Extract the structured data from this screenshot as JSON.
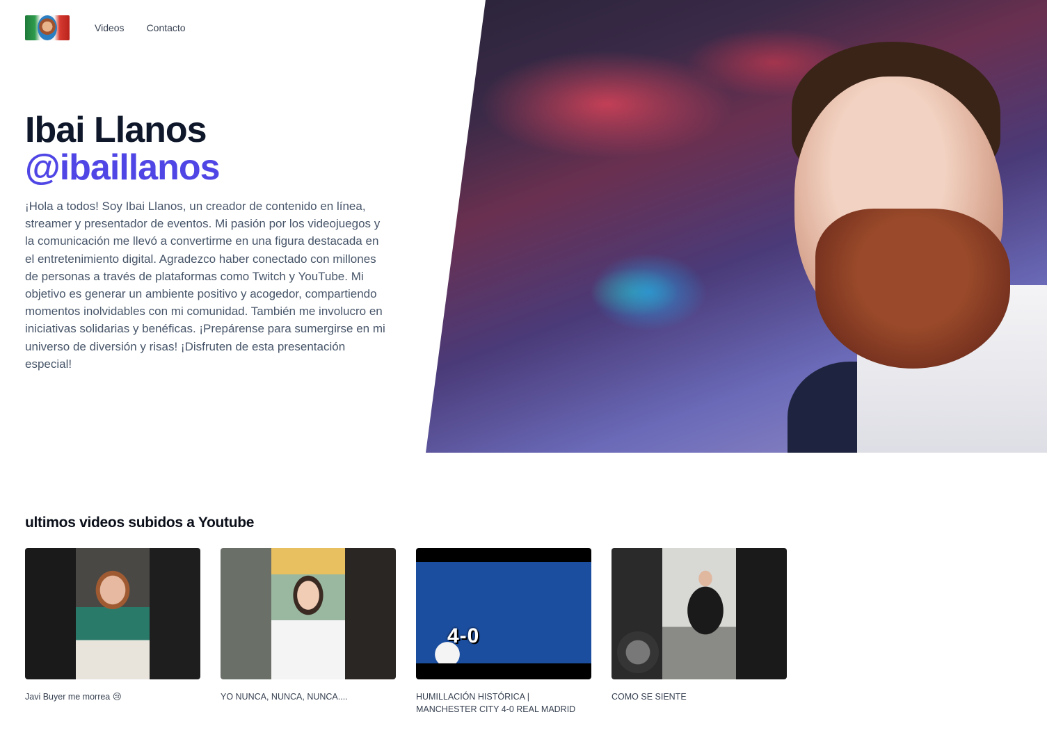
{
  "header": {
    "logo_alt": "Ibai logo",
    "nav": [
      "Videos",
      "Contacto"
    ]
  },
  "hero": {
    "name": "Ibai Llanos",
    "handle": "@ibaillanos",
    "description": "¡Hola a todos! Soy Ibai Llanos, un creador de contenido en línea, streamer y presentador de eventos. Mi pasión por los videojuegos y la comunicación me llevó a convertirme en una figura destacada en el entretenimiento digital. Agradezco haber conectado con millones de personas a través de plataformas como Twitch y YouTube. Mi objetivo es generar un ambiente positivo y acogedor, compartiendo momentos inolvidables con mi comunidad. También me involucro en iniciativas solidarias y benéficas. ¡Prepárense para sumergirse en mi universo de diversión y risas! ¡Disfruten de esta presentación especial!"
  },
  "videos": {
    "section_title": "ultimos videos subidos a Youtube",
    "items": [
      {
        "title": "Javi Buyer me morrea 😢"
      },
      {
        "title": "YO NUNCA, NUNCA, NUNCA...."
      },
      {
        "title": "HUMILLACIÓN HISTÓRICA | MANCHESTER CITY 4-0 REAL MADRID",
        "thumb_text": "4-0"
      },
      {
        "title": "COMO SE SIENTE"
      }
    ]
  },
  "colors": {
    "accent": "#4f46e5",
    "heading": "#0f172a",
    "body_text": "#475569"
  }
}
